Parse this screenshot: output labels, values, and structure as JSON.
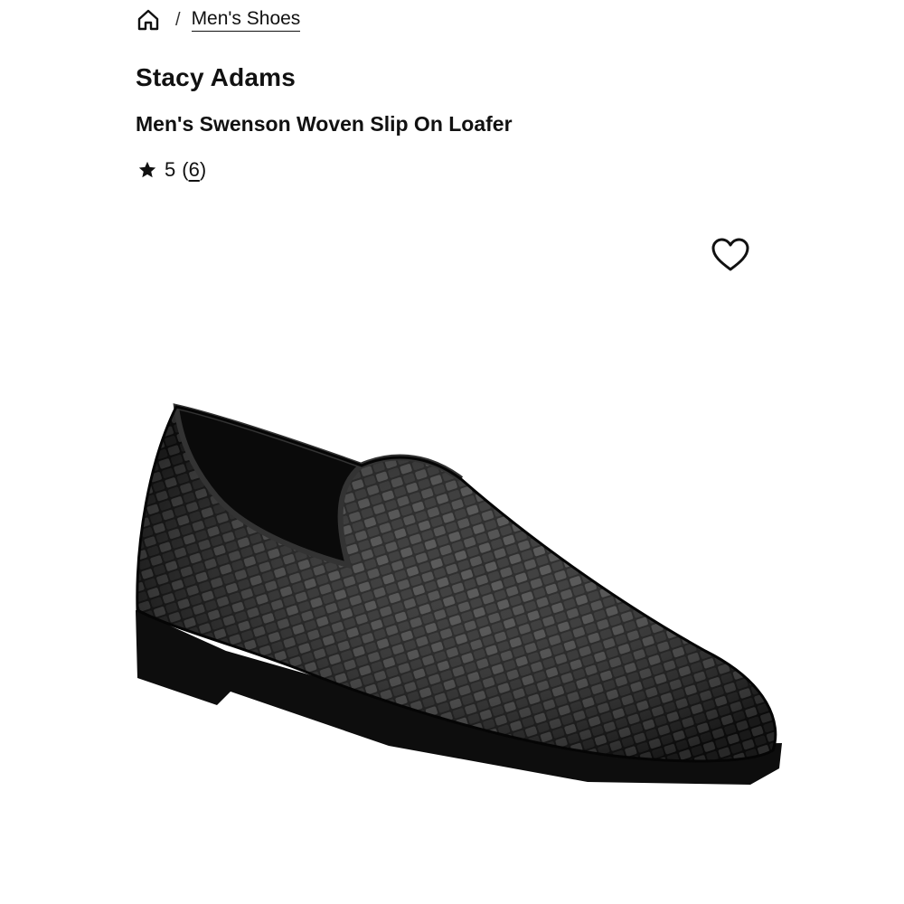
{
  "breadcrumb": {
    "home_icon": "home-icon",
    "separator": "/",
    "current_label": "Men's Shoes"
  },
  "product": {
    "brand": "Stacy Adams",
    "name": "Men's Swenson Woven Slip On Loafer",
    "rating_value": "5",
    "rating_count_open": "(",
    "rating_count": "6",
    "rating_count_close": ")",
    "rating_icon": "star-icon",
    "wishlist_icon": "heart-outline-icon",
    "image_alt": "Black woven slip-on loafer"
  },
  "colors": {
    "text": "#111111",
    "background": "#ffffff",
    "shoe": "#1a1a1a"
  }
}
